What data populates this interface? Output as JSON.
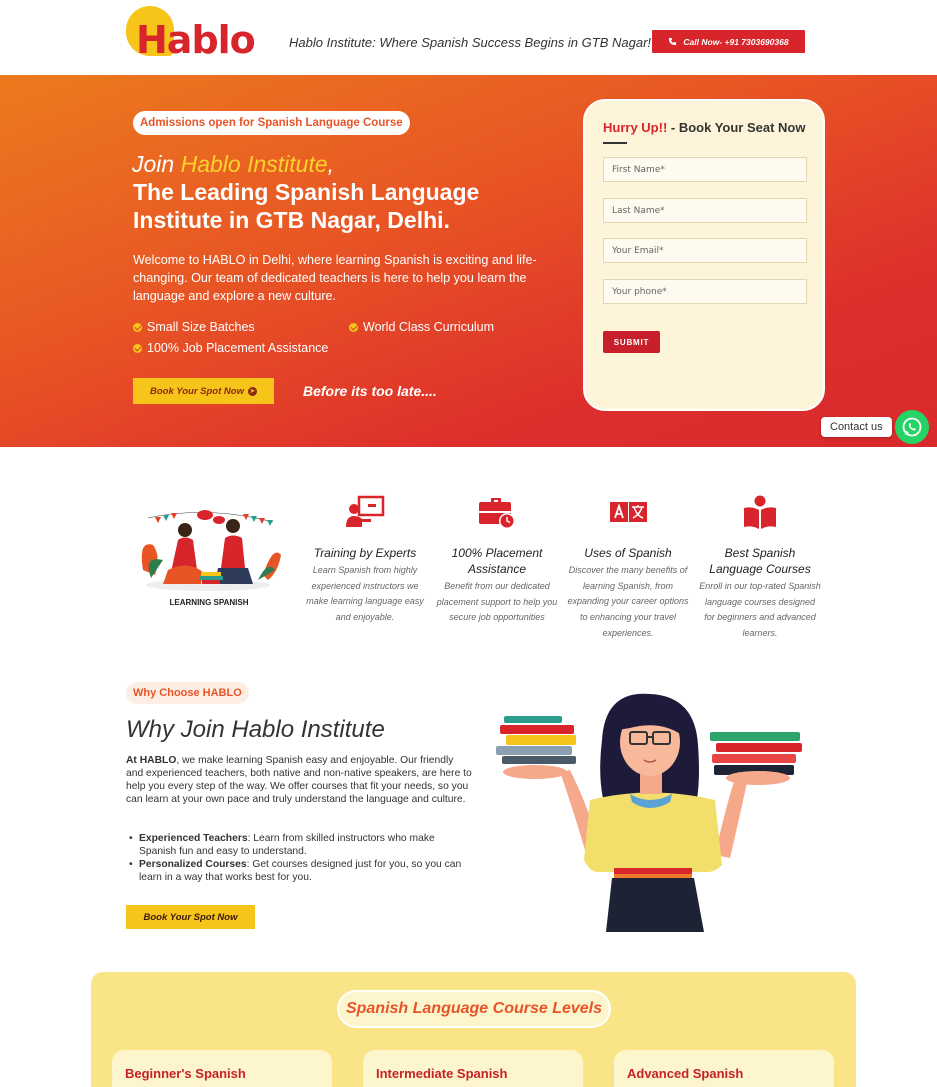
{
  "header": {
    "logo_text": "Hablo",
    "tagline": "Hablo Institute: Where Spanish Success Begins in GTB Nagar!",
    "call_button": "Call Now- +91 7303690368"
  },
  "hero": {
    "badge": "Admissions open for Spanish Language Course",
    "heading_prefix": "Join ",
    "heading_highlight": "Hablo Institute",
    "heading_suffix": ",",
    "heading_main": "The Leading Spanish Language Institute in GTB Nagar, Delhi.",
    "intro": "Welcome to HABLO in Delhi, where learning Spanish is exciting and life-changing. Our team of dedicated teachers is here to help you learn the language and explore a new culture.",
    "features": [
      "Small Size Batches",
      "World Class Curriculum",
      "100% Job Placement Assistance"
    ],
    "cta": "Book Your Spot Now",
    "urgency": "Before its too late...."
  },
  "form": {
    "title_highlight": "Hurry Up!!",
    "title_rest": " - Book Your Seat Now",
    "fields": [
      "First Name*",
      "Last Name*",
      "Your Email*",
      "Your phone*"
    ],
    "submit": "SUBMIT"
  },
  "contact": {
    "label": "Contact us",
    "icon": "whatsapp-icon"
  },
  "illustration": {
    "caption": "LEARNING SPANISH"
  },
  "features": [
    {
      "title": "Training by Experts",
      "desc": "Learn Spanish from highly experienced instructors we make learning language easy and enjoyable.",
      "icon": "teacher-board-icon"
    },
    {
      "title": "100% Placement Assistance",
      "desc": "Benefit from our dedicated placement support to help you secure job opportunities",
      "icon": "briefcase-clock-icon"
    },
    {
      "title": "Uses of Spanish",
      "desc": "Discover the many benefits of learning Spanish, from expanding your career options to enhancing your travel experiences.",
      "icon": "translate-icon"
    },
    {
      "title": "Best Spanish Language Courses",
      "desc": "Enroll in our top-rated Spanish language courses designed for beginners and advanced learners.",
      "icon": "reader-book-icon"
    }
  ],
  "why": {
    "badge": "Why Choose HABLO",
    "title": "Why Join Hablo Institute",
    "intro_bold": "At HABLO",
    "intro_rest": ", we make learning Spanish easy and enjoyable. Our friendly and experienced teachers, both native and non-native speakers, are here to help you every step of the way. We offer courses that fit your needs, so you can learn at your own pace and truly understand the language and culture.",
    "points": [
      {
        "bold": "Experienced Teachers",
        "text": ": Learn from skilled instructors who make Spanish fun and easy to understand."
      },
      {
        "bold": "Personalized Courses",
        "text": ": Get courses designed just for you, so you can learn in a way that works best for you."
      }
    ],
    "cta": "Book Your Spot Now"
  },
  "levels": {
    "title": "Spanish Language Course Levels",
    "cards": [
      "Beginner's Spanish",
      "Intermediate Spanish",
      "Advanced Spanish"
    ]
  },
  "colors": {
    "brand_red": "#d8242b",
    "brand_yellow": "#f7c41a",
    "hero_orange": "#ec7a1e"
  }
}
